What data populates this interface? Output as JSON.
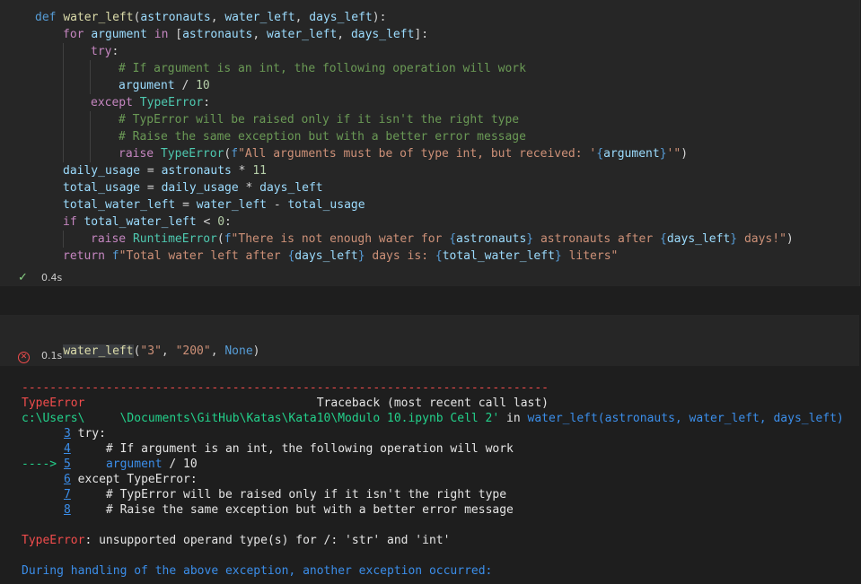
{
  "cell1": {
    "lines": [
      {
        "indent": 0,
        "parts": [
          [
            "kw",
            "def "
          ],
          [
            "fn",
            "water_left"
          ],
          [
            "plain",
            "("
          ],
          [
            "var",
            "astronauts"
          ],
          [
            "plain",
            ", "
          ],
          [
            "var",
            "water_left"
          ],
          [
            "plain",
            ", "
          ],
          [
            "var",
            "days_left"
          ],
          [
            "plain",
            "):"
          ]
        ]
      },
      {
        "indent": 1,
        "parts": [
          [
            "kwc",
            "for "
          ],
          [
            "var",
            "argument "
          ],
          [
            "kwc",
            "in "
          ],
          [
            "plain",
            "["
          ],
          [
            "var",
            "astronauts"
          ],
          [
            "plain",
            ", "
          ],
          [
            "var",
            "water_left"
          ],
          [
            "plain",
            ", "
          ],
          [
            "var",
            "days_left"
          ],
          [
            "plain",
            "]:"
          ]
        ]
      },
      {
        "indent": 2,
        "parts": [
          [
            "kwc",
            "try"
          ],
          [
            "plain",
            ":"
          ]
        ]
      },
      {
        "indent": 3,
        "parts": [
          [
            "cmt",
            "# If argument is an int, the following operation will work"
          ]
        ]
      },
      {
        "indent": 3,
        "parts": [
          [
            "var",
            "argument "
          ],
          [
            "plain",
            "/ "
          ],
          [
            "num",
            "10"
          ]
        ]
      },
      {
        "indent": 2,
        "parts": [
          [
            "kwc",
            "except "
          ],
          [
            "cls",
            "TypeError"
          ],
          [
            "plain",
            ":"
          ]
        ]
      },
      {
        "indent": 3,
        "parts": [
          [
            "cmt",
            "# TypError will be raised only if it isn't the right type"
          ]
        ]
      },
      {
        "indent": 3,
        "parts": [
          [
            "cmt",
            "# Raise the same exception but with a better error message"
          ]
        ]
      },
      {
        "indent": 3,
        "parts": [
          [
            "kwc",
            "raise "
          ],
          [
            "cls",
            "TypeError"
          ],
          [
            "plain",
            "("
          ],
          [
            "kw",
            "f"
          ],
          [
            "str",
            "\"All arguments must be of type int, but received: '"
          ],
          [
            "brace",
            "{"
          ],
          [
            "var",
            "argument"
          ],
          [
            "brace",
            "}"
          ],
          [
            "str",
            "'\""
          ],
          [
            "plain",
            ")"
          ]
        ]
      },
      {
        "indent": 1,
        "parts": [
          [
            "var",
            "daily_usage "
          ],
          [
            "plain",
            "= "
          ],
          [
            "var",
            "astronauts "
          ],
          [
            "plain",
            "* "
          ],
          [
            "num",
            "11"
          ]
        ]
      },
      {
        "indent": 1,
        "parts": [
          [
            "var",
            "total_usage "
          ],
          [
            "plain",
            "= "
          ],
          [
            "var",
            "daily_usage "
          ],
          [
            "plain",
            "* "
          ],
          [
            "var",
            "days_left"
          ]
        ]
      },
      {
        "indent": 1,
        "parts": [
          [
            "var",
            "total_water_left "
          ],
          [
            "plain",
            "= "
          ],
          [
            "var",
            "water_left "
          ],
          [
            "plain",
            "- "
          ],
          [
            "var",
            "total_usage"
          ]
        ]
      },
      {
        "indent": 1,
        "parts": [
          [
            "kwc",
            "if "
          ],
          [
            "var",
            "total_water_left "
          ],
          [
            "plain",
            "< "
          ],
          [
            "num",
            "0"
          ],
          [
            "plain",
            ":"
          ]
        ]
      },
      {
        "indent": 2,
        "parts": [
          [
            "kwc",
            "raise "
          ],
          [
            "cls",
            "RuntimeError"
          ],
          [
            "plain",
            "("
          ],
          [
            "kw",
            "f"
          ],
          [
            "str",
            "\"There is not enough water for "
          ],
          [
            "brace",
            "{"
          ],
          [
            "var",
            "astronauts"
          ],
          [
            "brace",
            "}"
          ],
          [
            "str",
            " astronauts after "
          ],
          [
            "brace",
            "{"
          ],
          [
            "var",
            "days_left"
          ],
          [
            "brace",
            "}"
          ],
          [
            "str",
            " days!\""
          ],
          [
            "plain",
            ")"
          ]
        ]
      },
      {
        "indent": 1,
        "parts": [
          [
            "kwc",
            "return "
          ],
          [
            "kw",
            "f"
          ],
          [
            "str",
            "\"Total water left after "
          ],
          [
            "brace",
            "{"
          ],
          [
            "var",
            "days_left"
          ],
          [
            "brace",
            "}"
          ],
          [
            "str",
            " days is: "
          ],
          [
            "brace",
            "{"
          ],
          [
            "var",
            "total_water_left"
          ],
          [
            "brace",
            "}"
          ],
          [
            "str",
            " liters\""
          ]
        ]
      }
    ],
    "status_icon": "check-icon",
    "status_glyph": "✓",
    "duration": "0.4s"
  },
  "cell2": {
    "call_name": "water_left",
    "call_rest": [
      [
        "plain",
        "("
      ],
      [
        "str",
        "\"3\""
      ],
      [
        "plain",
        ", "
      ],
      [
        "str",
        "\"200\""
      ],
      [
        "plain",
        ", "
      ],
      [
        "kw",
        "None"
      ],
      [
        "plain",
        ")"
      ]
    ],
    "status_icon": "error-circle-icon",
    "status_glyph": "✕",
    "duration": "0.1s"
  },
  "output": {
    "lines": [
      [
        [
          "red",
          "---------------------------------------------------------------------------"
        ]
      ],
      [
        [
          "red",
          "TypeError"
        ],
        [
          "white",
          "                                 Traceback (most recent call last)"
        ]
      ],
      [
        [
          "green",
          "c:\\Users\\     \\Documents\\GitHub\\Katas\\Kata10\\Modulo 10.ipynb Cell 2'"
        ],
        [
          "white",
          " in "
        ],
        [
          "blue",
          "water_left(astronauts, water_left, days_left)"
        ]
      ],
      [
        [
          "white",
          "      "
        ],
        [
          "lnk",
          "3"
        ],
        [
          "white",
          " try:"
        ]
      ],
      [
        [
          "white",
          "      "
        ],
        [
          "lnk",
          "4"
        ],
        [
          "white",
          "     # If argument is an int, the following operation will work"
        ]
      ],
      [
        [
          "green",
          "----> "
        ],
        [
          "lnk",
          "5"
        ],
        [
          "white",
          "     "
        ],
        [
          "blue",
          "argument"
        ],
        [
          "white",
          " / 10"
        ]
      ],
      [
        [
          "white",
          "      "
        ],
        [
          "lnk",
          "6"
        ],
        [
          "white",
          " except TypeError:"
        ]
      ],
      [
        [
          "white",
          "      "
        ],
        [
          "lnk",
          "7"
        ],
        [
          "white",
          "     # TypError will be raised only if it isn't the right type"
        ]
      ],
      [
        [
          "white",
          "      "
        ],
        [
          "lnk",
          "8"
        ],
        [
          "white",
          "     # Raise the same exception but with a better error message"
        ]
      ],
      [
        [
          "white",
          ""
        ]
      ],
      [
        [
          "red",
          "TypeError"
        ],
        [
          "white",
          ": unsupported operand type(s) for /: 'str' and 'int'"
        ]
      ],
      [
        [
          "white",
          ""
        ]
      ],
      [
        [
          "blue",
          "During handling of the above exception, another exception occurred:"
        ]
      ]
    ]
  }
}
